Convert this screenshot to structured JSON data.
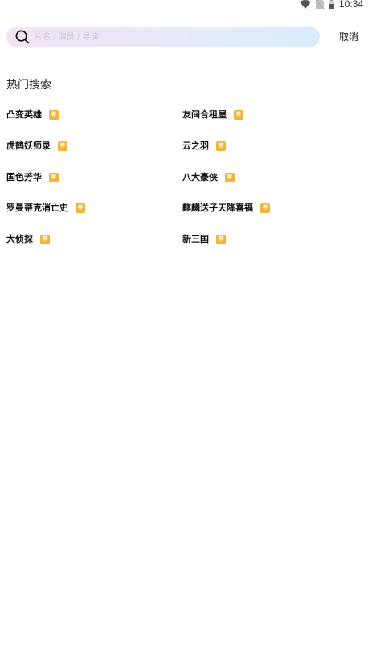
{
  "status_bar": {
    "time": "10:34",
    "icons": [
      "wifi-icon",
      "no-sim-icon",
      "battery-icon"
    ]
  },
  "search": {
    "placeholder": "片名 / 演员 / 导演",
    "value": "",
    "cancel_label": "取消"
  },
  "hot_search": {
    "title": "热门搜索",
    "badge_label": "荐",
    "badge_color": "#f2b53a",
    "items": [
      {
        "label": "凸变英雄"
      },
      {
        "label": "友间合租屋"
      },
      {
        "label": "虎鹤妖师录"
      },
      {
        "label": "云之羽"
      },
      {
        "label": "国色芳华"
      },
      {
        "label": "八大豪侠"
      },
      {
        "label": "罗曼蒂克消亡史"
      },
      {
        "label": "麒麟送子天降喜福"
      },
      {
        "label": "大侦探"
      },
      {
        "label": "新三国"
      }
    ]
  }
}
